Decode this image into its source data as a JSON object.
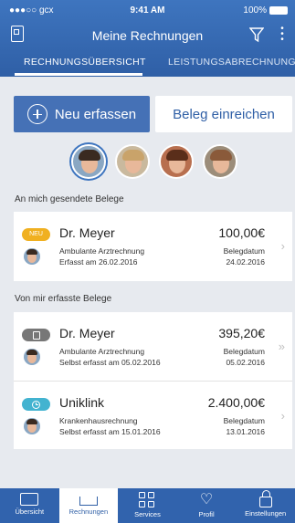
{
  "status": {
    "carrier": "●●●○○ gcx",
    "time": "9:41 AM",
    "battery": "100%"
  },
  "header": {
    "title": "Meine Rechnungen"
  },
  "tabs": [
    {
      "label": "RECHNUNGSÜBERSICHT"
    },
    {
      "label": "LEISTUNGSABRECHNUNG"
    }
  ],
  "actions": {
    "new_label": "Neu erfassen",
    "submit_label": "Beleg einreichen"
  },
  "sections": {
    "received": "An mich gesendete Belege",
    "entered": "Von mir erfasste Belege"
  },
  "received_items": [
    {
      "badge": "NEU",
      "name": "Dr. Meyer",
      "type": "Ambulante Arztrechnung",
      "entered": "Erfasst am 26.02.2016",
      "amount": "100,00€",
      "date_label": "Belegdatum",
      "date": "24.02.2016"
    }
  ],
  "entered_items": [
    {
      "badge_icon": "document-icon",
      "name": "Dr. Meyer",
      "type": "Ambulante Arztrechnung",
      "entered": "Selbst erfasst am 05.02.2016",
      "amount": "395,20€",
      "date_label": "Belegdatum",
      "date": "05.02.2016"
    },
    {
      "badge_icon": "clock-icon",
      "name": "Uniklink",
      "type": "Krankenhausrechnung",
      "entered": "Selbst erfasst am 15.01.2016",
      "amount": "2.400,00€",
      "date_label": "Belegdatum",
      "date": "13.01.2016"
    }
  ],
  "bottom_nav": [
    {
      "label": "Übersicht",
      "icon": "monitor-icon"
    },
    {
      "label": "Rechnungen",
      "icon": "inbox-icon"
    },
    {
      "label": "Services",
      "icon": "grid-icon"
    },
    {
      "label": "Profil",
      "icon": "heart-icon"
    },
    {
      "label": "Einstellungen",
      "icon": "lock-icon"
    }
  ],
  "colors": {
    "primary": "#3e75bf",
    "new_badge": "#f0b020",
    "progress_badge": "#43b3d0"
  }
}
